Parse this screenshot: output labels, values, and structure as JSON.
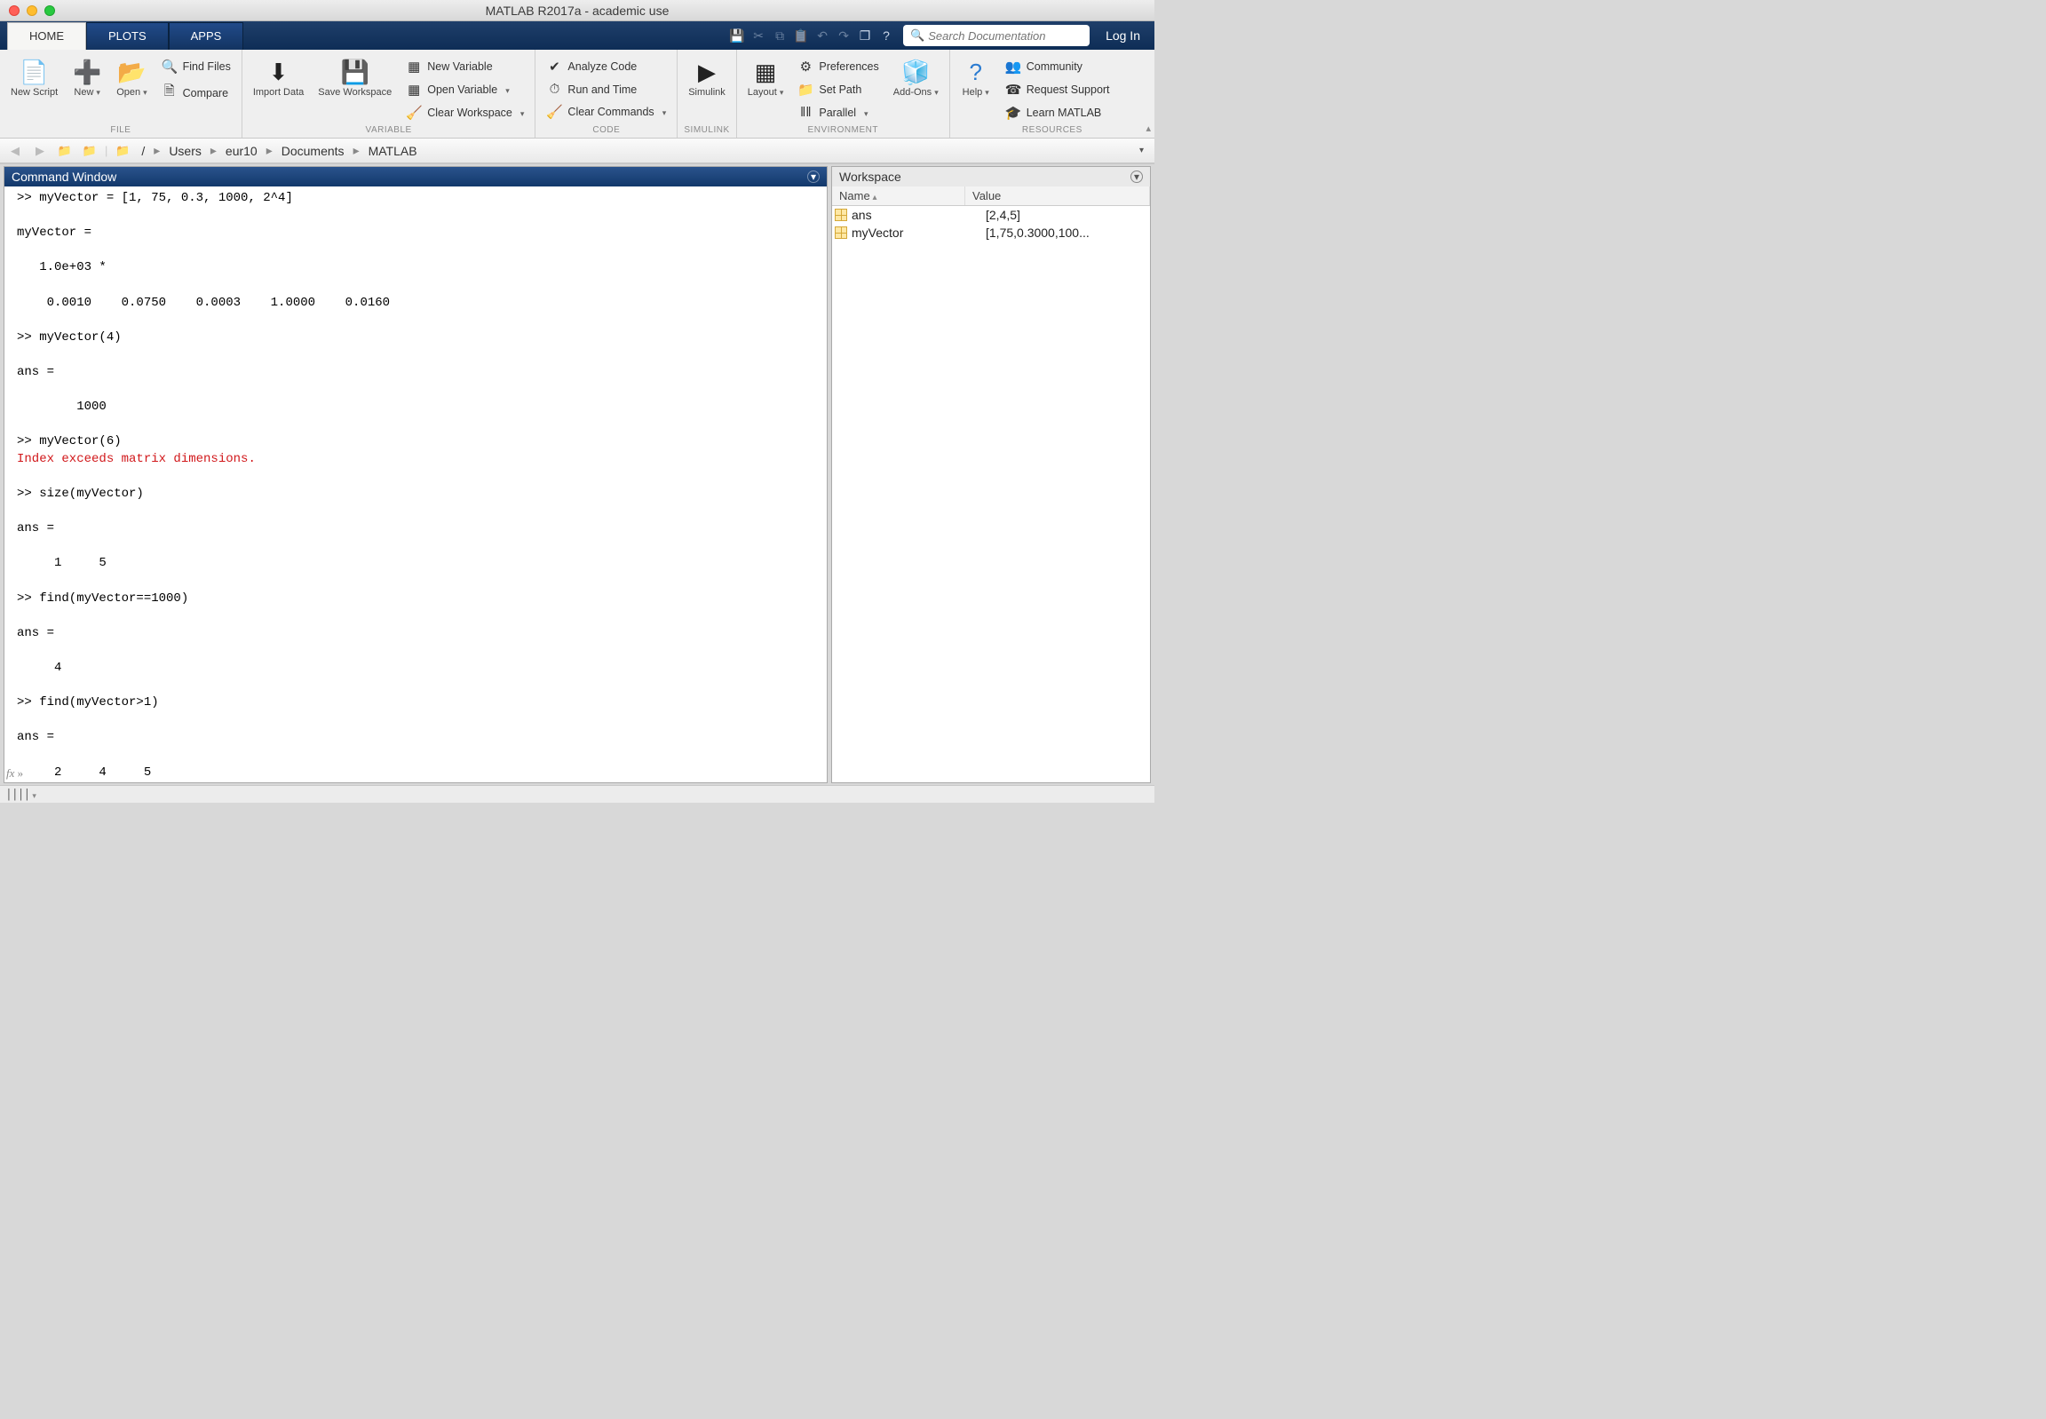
{
  "window": {
    "title": "MATLAB R2017a - academic use"
  },
  "tabs": {
    "home": "HOME",
    "plots": "PLOTS",
    "apps": "APPS"
  },
  "quick": {
    "search_ph": "Search Documentation",
    "login": "Log In"
  },
  "ribbon": {
    "file": {
      "label": "FILE",
      "new_script": "New\nScript",
      "new": "New",
      "open": "Open",
      "find_files": "Find Files",
      "compare": "Compare"
    },
    "variable": {
      "label": "VARIABLE",
      "import": "Import\nData",
      "save": "Save\nWorkspace",
      "new_var": "New Variable",
      "open_var": "Open Variable",
      "clear_ws": "Clear Workspace"
    },
    "code": {
      "label": "CODE",
      "analyze": "Analyze Code",
      "runtime": "Run and Time",
      "clearcmd": "Clear Commands"
    },
    "simulink": {
      "label": "SIMULINK",
      "simulink": "Simulink"
    },
    "environment": {
      "label": "ENVIRONMENT",
      "layout": "Layout",
      "prefs": "Preferences",
      "setpath": "Set Path",
      "parallel": "Parallel",
      "addons": "Add-Ons"
    },
    "resources": {
      "label": "RESOURCES",
      "help": "Help",
      "community": "Community",
      "support": "Request Support",
      "learn": "Learn MATLAB"
    }
  },
  "breadcrumb": {
    "parts": [
      "/",
      "Users",
      "eur10",
      "Documents",
      "MATLAB"
    ]
  },
  "command_window": {
    "title": "Command Window",
    "lines": [
      {
        "t": ">> myVector = [1, 75, 0.3, 1000, 2^4]"
      },
      {
        "t": ""
      },
      {
        "t": "myVector ="
      },
      {
        "t": ""
      },
      {
        "t": "   1.0e+03 *"
      },
      {
        "t": ""
      },
      {
        "t": "    0.0010    0.0750    0.0003    1.0000    0.0160"
      },
      {
        "t": ""
      },
      {
        "t": ">> myVector(4)"
      },
      {
        "t": ""
      },
      {
        "t": "ans ="
      },
      {
        "t": ""
      },
      {
        "t": "        1000"
      },
      {
        "t": ""
      },
      {
        "t": ">> myVector(6)"
      },
      {
        "t": "Index exceeds matrix dimensions.",
        "err": true
      },
      {
        "t": ""
      },
      {
        "t": ">> size(myVector)"
      },
      {
        "t": ""
      },
      {
        "t": "ans ="
      },
      {
        "t": ""
      },
      {
        "t": "     1     5"
      },
      {
        "t": ""
      },
      {
        "t": ">> find(myVector==1000)"
      },
      {
        "t": ""
      },
      {
        "t": "ans ="
      },
      {
        "t": ""
      },
      {
        "t": "     4"
      },
      {
        "t": ""
      },
      {
        "t": ">> find(myVector>1)"
      },
      {
        "t": ""
      },
      {
        "t": "ans ="
      },
      {
        "t": ""
      },
      {
        "t": "     2     4     5"
      }
    ],
    "fx": "fx"
  },
  "workspace": {
    "title": "Workspace",
    "cols": {
      "name": "Name",
      "value": "Value"
    },
    "rows": [
      {
        "name": "ans",
        "value": "[2,4,5]"
      },
      {
        "name": "myVector",
        "value": "[1,75,0.3000,100..."
      }
    ]
  }
}
